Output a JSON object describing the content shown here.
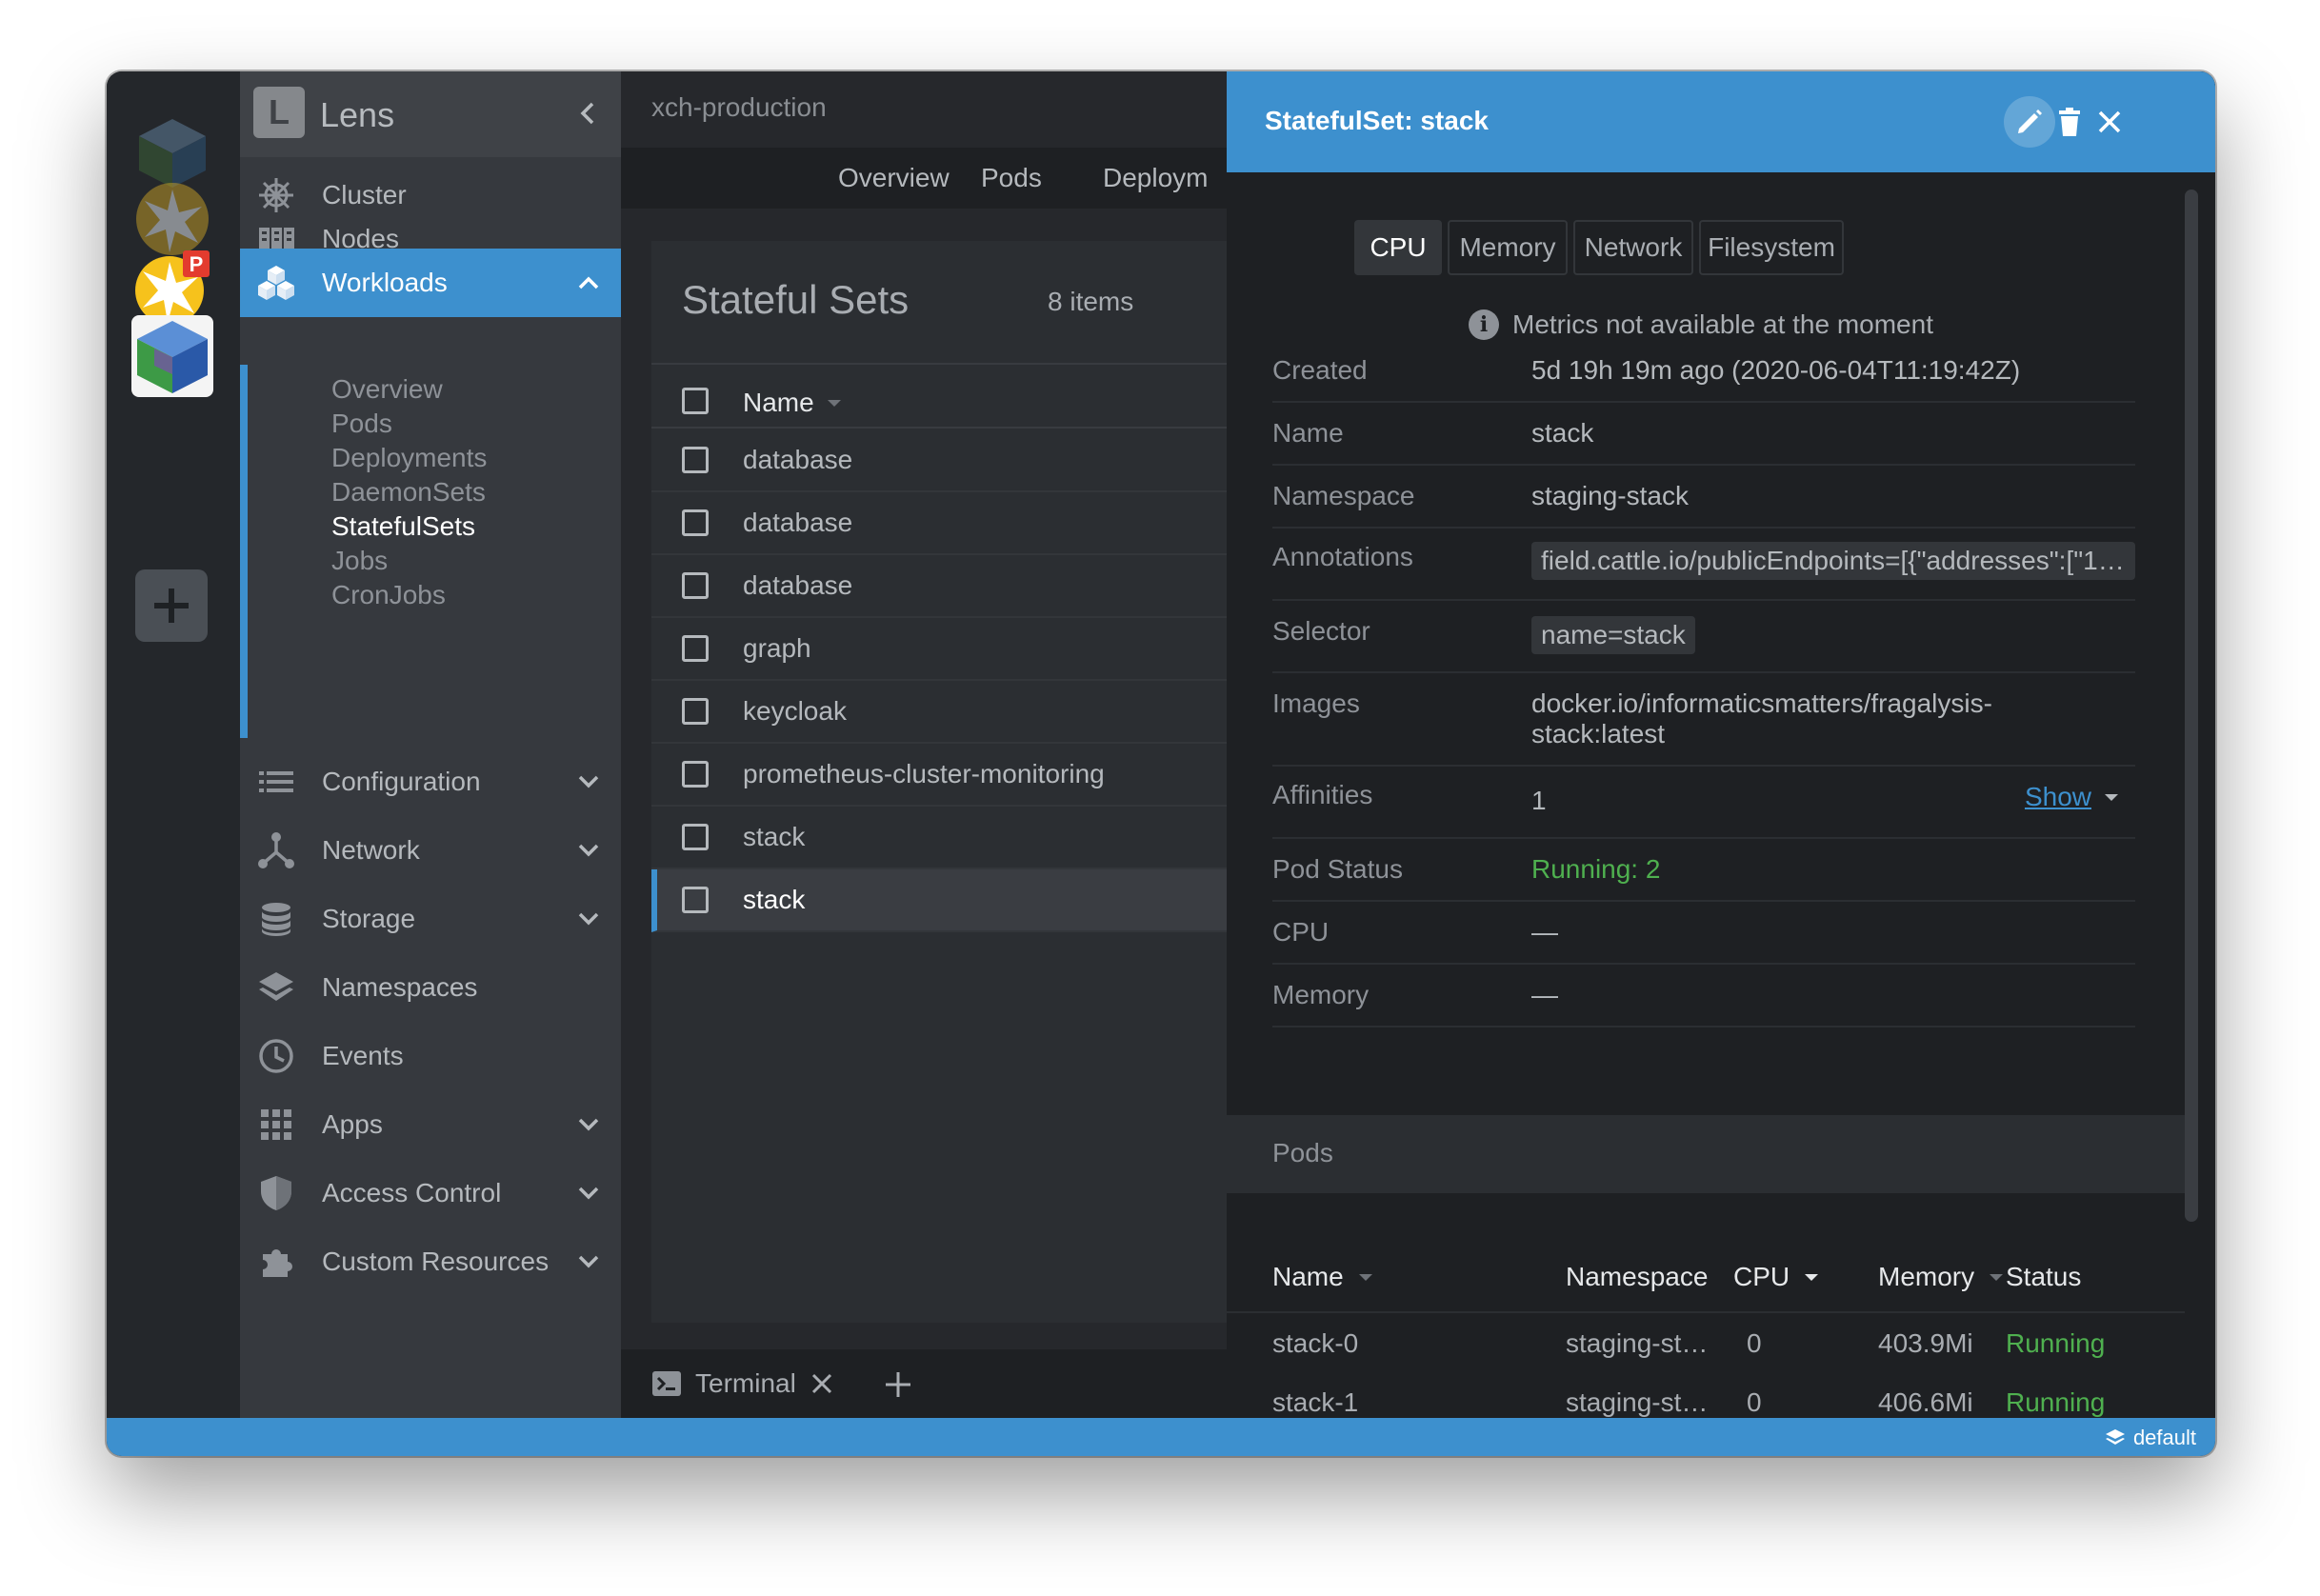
{
  "app": {
    "name": "Lens",
    "logo_letter": "L"
  },
  "header": {
    "namespace": "xch-production"
  },
  "tabs": [
    {
      "label": "Overview"
    },
    {
      "label": "Pods"
    },
    {
      "label": "Deploym"
    }
  ],
  "sidebar": {
    "items": [
      {
        "label": "Cluster",
        "icon": "helm-wheel-icon"
      },
      {
        "label": "Nodes",
        "icon": "server-rack-icon"
      },
      {
        "label": "Workloads",
        "icon": "cubes-icon",
        "active": true
      },
      {
        "label": "Configuration",
        "icon": "list-icon"
      },
      {
        "label": "Network",
        "icon": "network-icon"
      },
      {
        "label": "Storage",
        "icon": "database-icon"
      },
      {
        "label": "Namespaces",
        "icon": "layers-icon"
      },
      {
        "label": "Events",
        "icon": "clock-icon"
      },
      {
        "label": "Apps",
        "icon": "grid-icon"
      },
      {
        "label": "Access Control",
        "icon": "shield-icon"
      },
      {
        "label": "Custom Resources",
        "icon": "puzzle-icon"
      }
    ],
    "workloads_sub": [
      "Overview",
      "Pods",
      "Deployments",
      "DaemonSets",
      "StatefulSets",
      "Jobs",
      "CronJobs"
    ],
    "active_sub": "StatefulSets"
  },
  "list": {
    "title": "Stateful Sets",
    "count": "8 items",
    "column_name": "Name",
    "rows": [
      "database",
      "database",
      "database",
      "graph",
      "keycloak",
      "prometheus-cluster-monitoring",
      "stack",
      "stack"
    ]
  },
  "dock": {
    "terminal_label": "Terminal"
  },
  "status": {
    "namespace": "default",
    "color": "#3d90ce"
  },
  "drawer": {
    "title": "StatefulSet: stack",
    "metric_tabs": [
      "CPU",
      "Memory",
      "Network",
      "Filesystem"
    ],
    "metrics_message": "Metrics not available at the moment",
    "details": {
      "created": {
        "key": "Created",
        "value": "5d 19h 19m ago (2020-06-04T11:19:42Z)"
      },
      "name": {
        "key": "Name",
        "value": "stack"
      },
      "namespace": {
        "key": "Namespace",
        "value": "staging-stack"
      },
      "annotations": {
        "key": "Annotations",
        "value": "field.cattle.io/publicEndpoints=[{\"addresses\":[\"1…"
      },
      "selector": {
        "key": "Selector",
        "value": "name=stack"
      },
      "images": {
        "key": "Images",
        "value_line1": "docker.io/informaticsmatters/fragalysis-",
        "value_line2": "stack:latest"
      },
      "affinities": {
        "key": "Affinities",
        "value": "1",
        "link": "Show"
      },
      "pod_status": {
        "key": "Pod Status",
        "value": "Running: 2"
      },
      "cpu": {
        "key": "CPU",
        "value": "—"
      },
      "memory": {
        "key": "Memory",
        "value": "—"
      }
    },
    "pods": {
      "title": "Pods",
      "columns": {
        "name": "Name",
        "namespace": "Namespace",
        "cpu": "CPU",
        "memory": "Memory",
        "status": "Status"
      },
      "rows": [
        {
          "name": "stack-0",
          "namespace": "staging-st…",
          "cpu": "0",
          "memory": "403.9Mi",
          "status": "Running"
        },
        {
          "name": "stack-1",
          "namespace": "staging-st…",
          "cpu": "0",
          "memory": "406.6Mi",
          "status": "Running"
        }
      ]
    }
  }
}
